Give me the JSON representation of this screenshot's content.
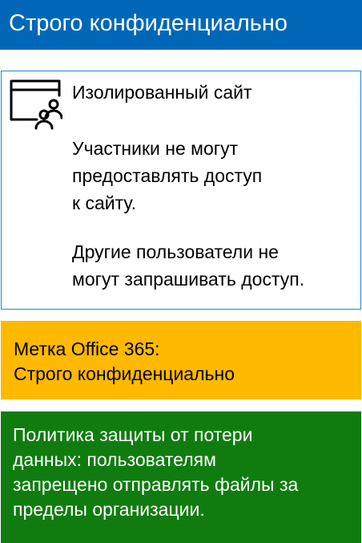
{
  "header": {
    "title": "Строго конфиденциально"
  },
  "site": {
    "icon": "site-window-people-icon",
    "title": "Изолированный сайт",
    "para1_lines": [
      "Участники не могут",
      "предоставлять доступ",
      "к сайту."
    ],
    "para2_lines": [
      "Другие пользователи не",
      "могут запрашивать доступ."
    ]
  },
  "label": {
    "lines": [
      "Метка Office 365:",
      "Строго конфиденциально"
    ]
  },
  "dlp": {
    "lines": [
      "Политика защиты от потери",
      "данных: пользователям",
      "запрещено отправлять файлы за",
      "пределы организации."
    ]
  },
  "colors": {
    "header_bg": "#0067b8",
    "site_border": "#1b88d8",
    "label_bg": "#ffb900",
    "dlp_bg": "#107c10"
  }
}
